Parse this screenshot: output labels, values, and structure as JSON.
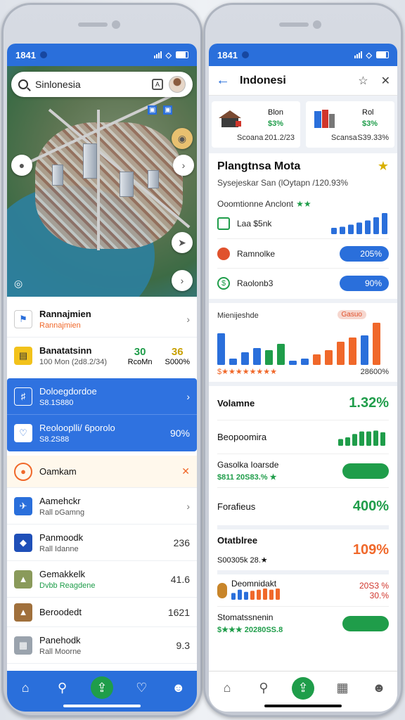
{
  "left": {
    "status": {
      "time": "1841"
    },
    "search": {
      "value": "Sinlonesia",
      "icon_label": "A"
    },
    "map_badges": [
      "▣",
      "▣"
    ],
    "card1": {
      "rows": [
        {
          "title": "Rannajmien",
          "subtitle": "Rannajmien",
          "icon": "flag-icon"
        },
        {
          "title": "Banatatsinn",
          "subtitle": "100 Mon (2d8.2/34)",
          "col1_top": "30",
          "col1_bottom": "RcoMn",
          "col2_top": "36",
          "col2_bottom": "S000%",
          "icon": "bed-icon"
        }
      ]
    },
    "bluecard": {
      "rows": [
        {
          "title": "Doloegdordoe",
          "subtitle": "S8.1S880",
          "icon": "tag-icon"
        },
        {
          "title": "Reolooplli/ 6porolo",
          "subtitle": "S8.2S88",
          "value": "90%",
          "icon": "heart-icon"
        }
      ]
    },
    "list": [
      {
        "title": "Oamkam",
        "subtitle": "",
        "value": "",
        "icon": "circle-icon",
        "accent": "#f0682a"
      },
      {
        "title": "Aamehckr",
        "subtitle": "Rall ᴅGamng",
        "value": "",
        "icon": "plane-icon"
      },
      {
        "title": "Panmoodk",
        "subtitle": "Rall Idanne",
        "value": "236",
        "icon": "shield-icon"
      },
      {
        "title": "Gemakkelk",
        "subtitle": "Dvbb Reagdene",
        "value": "41.6",
        "icon": "landscape-icon"
      },
      {
        "title": "Beroodedt",
        "subtitle": "",
        "value": "1621",
        "icon": "landscape-icon"
      },
      {
        "title": "Panehodk",
        "subtitle": "Rall Moorne",
        "value": "9.3",
        "icon": "building-icon"
      }
    ]
  },
  "right": {
    "status": {
      "time": "1841"
    },
    "header": {
      "title": "Indonesi"
    },
    "tiles": [
      {
        "name": "Blon",
        "pct": "$3%",
        "left": "Scoana",
        "right": "201.2/23"
      },
      {
        "name": "Rol",
        "pct": "$3%",
        "left": "Scansa",
        "right": "S39.33%"
      }
    ],
    "section1": {
      "title": "Plangtnsa Mota",
      "subtitle": "Sysejeskar San (lOytapn /120.93%",
      "rating_label": "Ooomtionne Anclont",
      "rows": [
        {
          "label": "Laa $5nk",
          "value": "",
          "icon": "doc-icon"
        },
        {
          "label": "Ramnolke",
          "value": "205%",
          "icon": "pill-icon"
        },
        {
          "label": "Raolonb3",
          "value": "90%",
          "icon": "dollar-icon"
        }
      ]
    },
    "chart": {
      "title": "Mienijeshde",
      "badge": "Gasuo",
      "foot_right": "28600%",
      "stars": "$★★★★★★★★"
    },
    "metrics": [
      {
        "label": "Volamne",
        "value": "1.32%",
        "color": "green"
      },
      {
        "label": "Beopoomira",
        "value": "",
        "color": "green"
      },
      {
        "label": "Gasolka Ioarsde",
        "sub": "$811 20S83.% ★",
        "value": "",
        "color": "green"
      },
      {
        "label": "Forafieus",
        "value": "400%",
        "color": "green"
      },
      {
        "label": "Otatblree",
        "sub": "S00305k 28.★",
        "value": "109%",
        "color": "orange"
      },
      {
        "label": "Deomnidakt",
        "value": "20S3 %",
        "value2": "30.%",
        "color": "red"
      },
      {
        "label": "Stomatssnenin",
        "sub": "$★★★ 20280SS.8",
        "value": "",
        "color": "green"
      }
    ]
  },
  "colors": {
    "primary": "#2a6fdb",
    "green": "#1f9d4a",
    "orange": "#f0682a",
    "red": "#d0352b"
  }
}
